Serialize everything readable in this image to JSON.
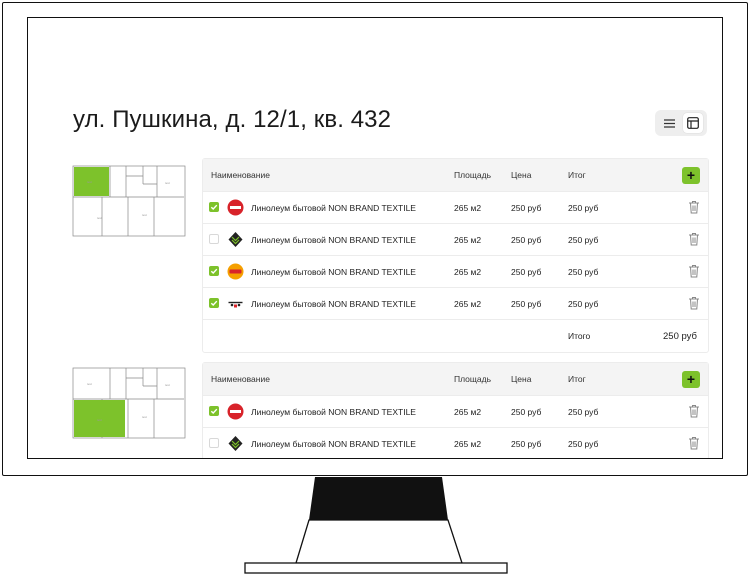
{
  "page": {
    "title": "ул. Пушкина, д. 12/1, кв. 432"
  },
  "colors": {
    "accent": "#7dc22b",
    "header_bg": "#f4f4f4",
    "border": "#ececec"
  },
  "icons": {
    "view_list": "list-icon",
    "view_grid": "grid-icon",
    "add": "plus-icon",
    "delete": "trash-icon"
  },
  "columns": {
    "name": "Наименование",
    "area": "Площадь",
    "price": "Цена",
    "total": "Итог"
  },
  "add_label": "+",
  "rooms": [
    {
      "items": [
        {
          "checked": true,
          "brand": "red-brand-logo",
          "name": "Линолеум бытовой NON BRAND TEXTILE",
          "area": "265 м2",
          "price": "250 руб",
          "total": "250 руб"
        },
        {
          "checked": false,
          "brand": "green-cube-logo",
          "name": "Линолеум бытовой NON BRAND TEXTILE",
          "area": "265 м2",
          "price": "250 руб",
          "total": "250 руб"
        },
        {
          "checked": true,
          "brand": "orange-brand-logo",
          "name": "Линолеум бытовой NON BRAND TEXTILE",
          "area": "265 м2",
          "price": "250 руб",
          "total": "250 руб"
        },
        {
          "checked": true,
          "brand": "skateboard-logo",
          "name": "Линолеум бытовой NON BRAND TEXTILE",
          "area": "265 м2",
          "price": "250 руб",
          "total": "250 руб"
        }
      ],
      "summary": {
        "label": "Итого",
        "value": "250 руб"
      }
    },
    {
      "items": [
        {
          "checked": true,
          "brand": "red-brand-logo",
          "name": "Линолеум бытовой NON BRAND TEXTILE",
          "area": "265 м2",
          "price": "250 руб",
          "total": "250 руб"
        },
        {
          "checked": false,
          "brand": "green-cube-logo",
          "name": "Линолеум бытовой NON BRAND TEXTILE",
          "area": "265 м2",
          "price": "250 руб",
          "total": "250 руб"
        }
      ]
    }
  ]
}
